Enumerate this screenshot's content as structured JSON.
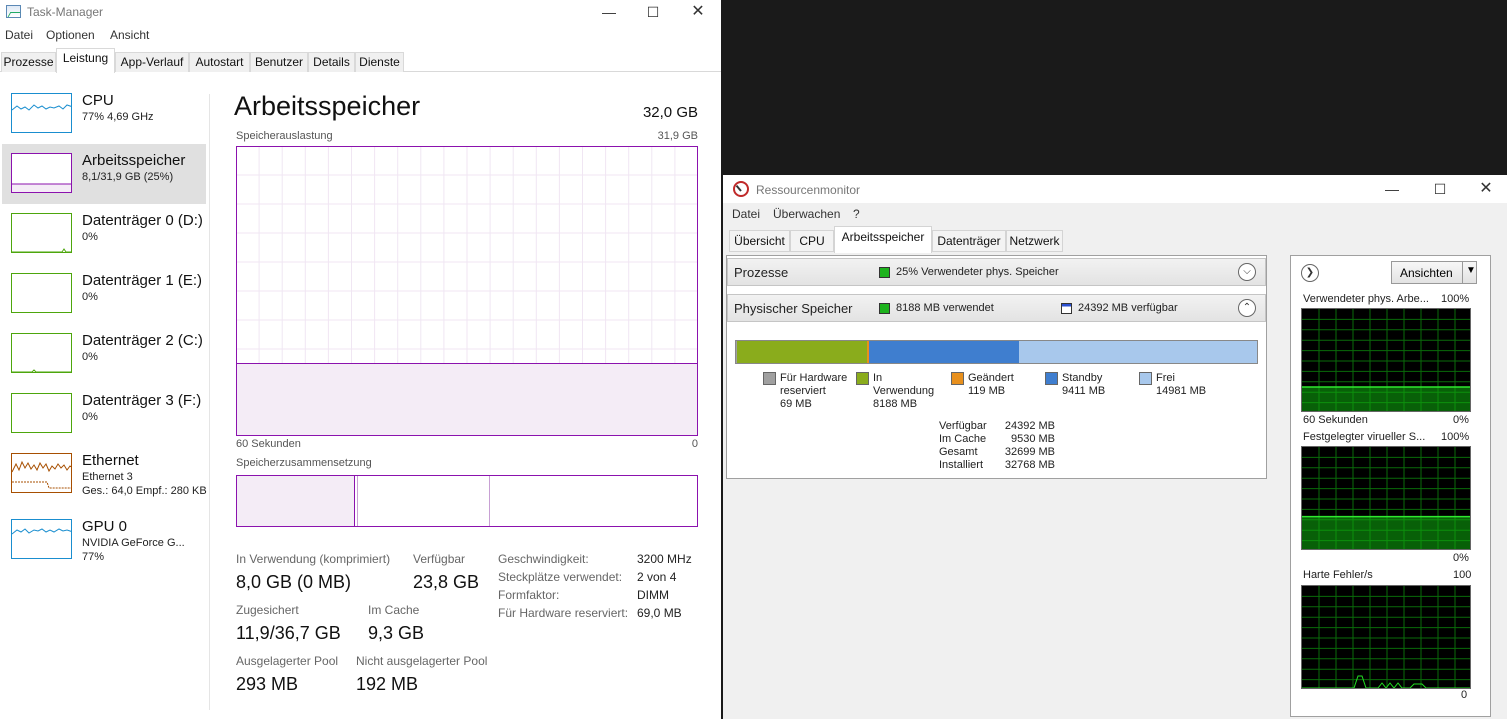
{
  "task_manager": {
    "title": "Task-Manager",
    "menu": [
      "Datei",
      "Optionen",
      "Ansicht"
    ],
    "tabs": [
      "Prozesse",
      "Leistung",
      "App-Verlauf",
      "Autostart",
      "Benutzer",
      "Details",
      "Dienste"
    ],
    "active_tab": "Leistung",
    "sidebar": [
      {
        "title": "CPU",
        "sub": "77% 4,69 GHz",
        "sub2": "",
        "color": "#1a8ecf",
        "icon": "cpu-graph-icon"
      },
      {
        "title": "Arbeitsspeicher",
        "sub": "8,1/31,9 GB (25%)",
        "sub2": "",
        "color": "#8b12ae",
        "icon": "memory-graph-icon"
      },
      {
        "title": "Datenträger 0 (D:)",
        "sub": "0%",
        "sub2": "",
        "color": "#4da60c",
        "icon": "disk-graph-icon"
      },
      {
        "title": "Datenträger 1 (E:)",
        "sub": "0%",
        "sub2": "",
        "color": "#4da60c",
        "icon": "disk-graph-icon"
      },
      {
        "title": "Datenträger 2 (C:)",
        "sub": "0%",
        "sub2": "",
        "color": "#4da60c",
        "icon": "disk-graph-icon"
      },
      {
        "title": "Datenträger 3 (F:)",
        "sub": "0%",
        "sub2": "",
        "color": "#4da60c",
        "icon": "disk-graph-icon"
      },
      {
        "title": "Ethernet",
        "sub": "Ethernet 3",
        "sub2": "Ges.: 64,0 Empf.: 280 KB",
        "color": "#a74f01",
        "icon": "network-graph-icon"
      },
      {
        "title": "GPU 0",
        "sub": "NVIDIA GeForce G...",
        "sub2": "77%",
        "color": "#1a8ecf",
        "icon": "gpu-graph-icon"
      }
    ],
    "main": {
      "title": "Arbeitsspeicher",
      "total": "32,0 GB",
      "usage_label": "Speicherauslastung",
      "usage_max": "31,9 GB",
      "time_label": "60 Sekunden",
      "zero_label": "0",
      "composition_label": "Speicherzusammensetzung",
      "stats": {
        "in_use_label": "In Verwendung (komprimiert)",
        "in_use_value": "8,0 GB (0 MB)",
        "available_label": "Verfügbar",
        "available_value": "23,8 GB",
        "committed_label": "Zugesichert",
        "committed_value": "11,9/36,7 GB",
        "cached_label": "Im Cache",
        "cached_value": "9,3 GB",
        "paged_label": "Ausgelagerter Pool",
        "paged_value": "293 MB",
        "nonpaged_label": "Nicht ausgelagerter Pool",
        "nonpaged_value": "192 MB"
      },
      "details": [
        {
          "key": "Geschwindigkeit:",
          "value": "3200 MHz"
        },
        {
          "key": "Steckplätze verwendet:",
          "value": "2 von 4"
        },
        {
          "key": "Formfaktor:",
          "value": "DIMM"
        },
        {
          "key": "Für Hardware reserviert:",
          "value": "69,0 MB"
        }
      ],
      "usage_fraction": 0.25
    },
    "accent_color": "#8b12ae"
  },
  "resource_monitor": {
    "title": "Ressourcenmonitor",
    "menu": [
      "Datei",
      "Überwachen",
      "?"
    ],
    "tabs": [
      "Übersicht",
      "CPU",
      "Arbeitsspeicher",
      "Datenträger",
      "Netzwerk"
    ],
    "active_tab": "Arbeitsspeicher",
    "processes_header": "Prozesse",
    "processes_status": "25% Verwendeter phys. Speicher",
    "physical_header": "Physischer Speicher",
    "physical_used": "8188 MB verwendet",
    "physical_available": "24392 MB verfügbar",
    "bar": [
      {
        "label": "Für Hardware reserviert",
        "mb": 69,
        "color": "#a0a0a0"
      },
      {
        "label": "In Verwendung",
        "mb": 8188,
        "color": "#8aac1c"
      },
      {
        "label": "Geändert",
        "mb": 119,
        "color": "#e8901d"
      },
      {
        "label": "Standby",
        "mb": 9411,
        "color": "#3f7ecf"
      },
      {
        "label": "Frei",
        "mb": 14981,
        "color": "#a8c8ec"
      }
    ],
    "legend": [
      {
        "text": "Für Hardware\nreserviert\n69 MB",
        "color": "#a0a0a0"
      },
      {
        "text": "In\nVerwendung\n8188 MB",
        "color": "#8aac1c"
      },
      {
        "text": "Geändert\n119 MB",
        "color": "#e8901d"
      },
      {
        "text": "Standby\n9411 MB",
        "color": "#3f7ecf"
      },
      {
        "text": "Frei\n14981 MB",
        "color": "#a8c8ec"
      }
    ],
    "summary": [
      {
        "key": "Verfügbar",
        "value": "24392 MB"
      },
      {
        "key": "Im Cache",
        "value": "9530 MB"
      },
      {
        "key": "Gesamt",
        "value": "32699 MB"
      },
      {
        "key": "Installiert",
        "value": "32768 MB"
      }
    ],
    "views_button": "Ansichten",
    "graphs": [
      {
        "title": "Verwendeter phys. Arbe...",
        "max": "100%",
        "time": "60 Sekunden",
        "min": "0%",
        "level": 0.25
      },
      {
        "title": "Festgelegter virueller S...",
        "max": "100%",
        "time": "",
        "min": "0%",
        "level": 0.33
      },
      {
        "title": "Harte Fehler/s",
        "max": "100",
        "time": "",
        "min": "0",
        "level": 0.02
      }
    ]
  }
}
